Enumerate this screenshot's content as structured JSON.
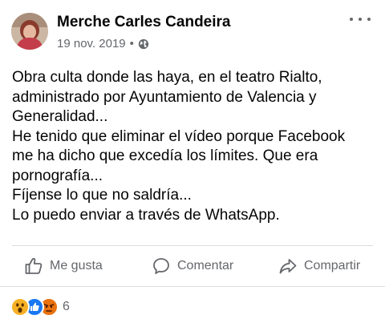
{
  "post": {
    "author": "Merche Carles Candeira",
    "date": "19 nov. 2019",
    "separator": "•",
    "text_lines": [
      "Obra culta donde las haya, en el teatro Rialto,",
      "administrado por Ayuntamiento de Valencia y",
      "Generalidad...",
      "He tenido que eliminar el vídeo porque Facebook",
      "me ha dicho que excedía los límites. Que era",
      "pornografía...",
      "Fíjense lo que no saldría...",
      "Lo puedo enviar a través de WhatsApp."
    ]
  },
  "actions": {
    "like_label": "Me gusta",
    "comment_label": "Comentar",
    "share_label": "Compartir"
  },
  "reactions": {
    "icons": [
      "wow-icon",
      "like-icon",
      "angry-icon"
    ],
    "count": "6"
  },
  "colors": {
    "text_primary": "#050505",
    "text_secondary": "#65676b",
    "divider": "#dadde1",
    "like_blue": "#1877f2",
    "wow_yellow": "#f7b125",
    "angry_orange": "#e9710f"
  }
}
